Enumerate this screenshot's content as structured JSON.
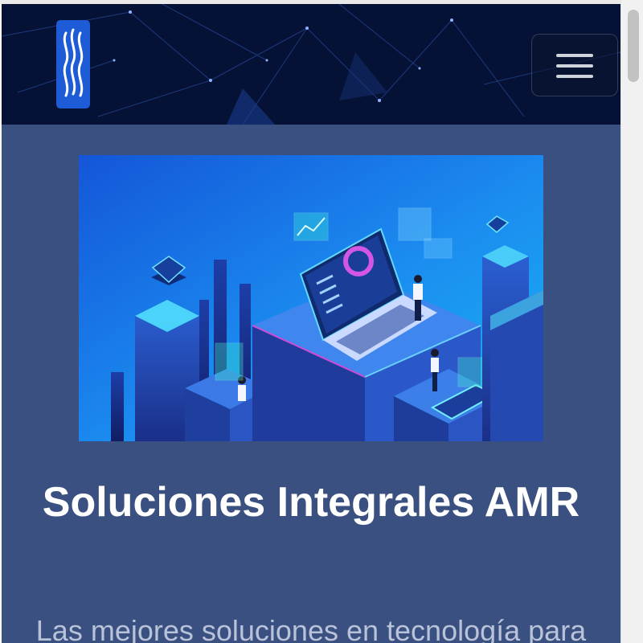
{
  "header": {
    "logo": {
      "icon": "wave-logo-icon"
    },
    "menu_toggle": {
      "icon": "hamburger-icon"
    }
  },
  "hero": {
    "illustration": "isometric-tech-city-illustration",
    "title": "Soluciones Integrales AMR",
    "subtitle": "Las mejores soluciones en tecnología para"
  },
  "colors": {
    "page_background": "#3a5080",
    "navbar_background": "#061235",
    "logo_blue": "#1e5bd6",
    "title_text": "#ffffff",
    "subtitle_text": "#b8c2d8"
  }
}
